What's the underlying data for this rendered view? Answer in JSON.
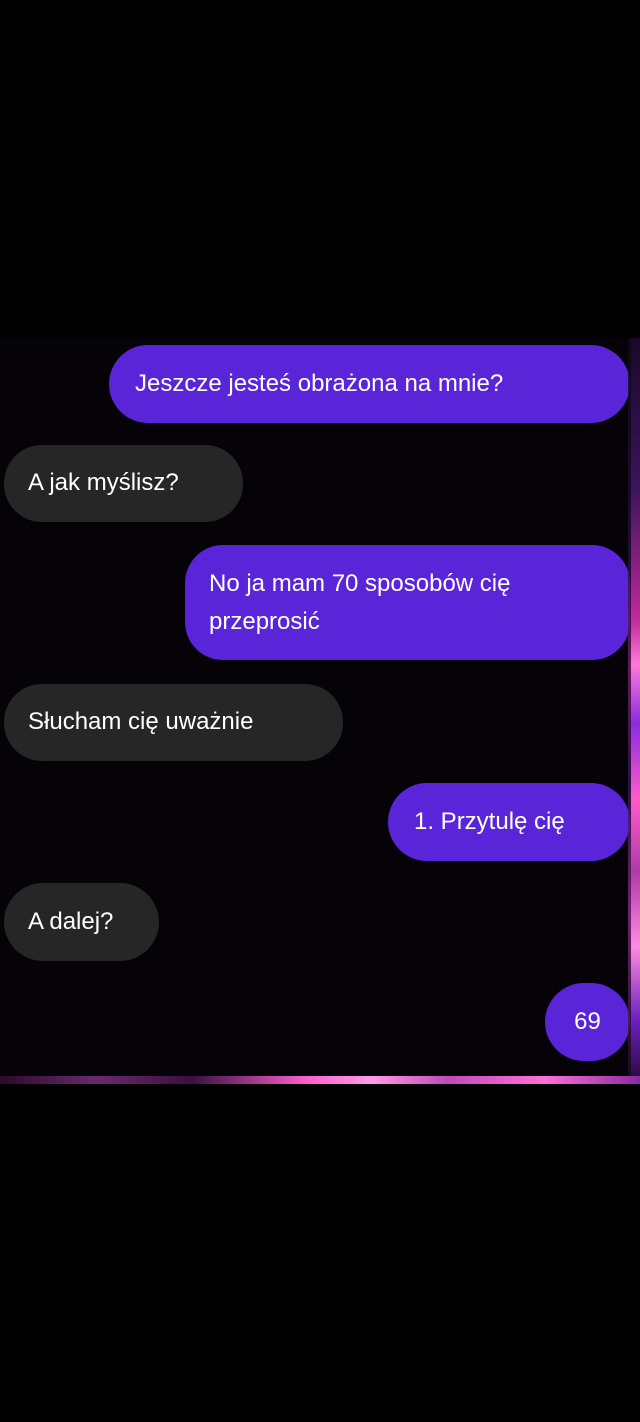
{
  "conversation": {
    "colors": {
      "sent_bubble": "#5a25d9",
      "received_bubble": "#262626",
      "text": "#ffffff",
      "background": "#000000"
    },
    "messages": [
      {
        "direction": "sent",
        "text": "Jeszcze jesteś obrażona na mnie?"
      },
      {
        "direction": "received",
        "text": "A jak myślisz?"
      },
      {
        "direction": "sent",
        "lines": [
          "No ja mam 70 sposobów cię",
          "przeprosić"
        ]
      },
      {
        "direction": "received",
        "text": "Słucham cię uważnie"
      },
      {
        "direction": "sent",
        "text": "1. Przytulę cię"
      },
      {
        "direction": "received",
        "text": "A dalej?"
      },
      {
        "direction": "sent",
        "text": "69"
      }
    ]
  }
}
